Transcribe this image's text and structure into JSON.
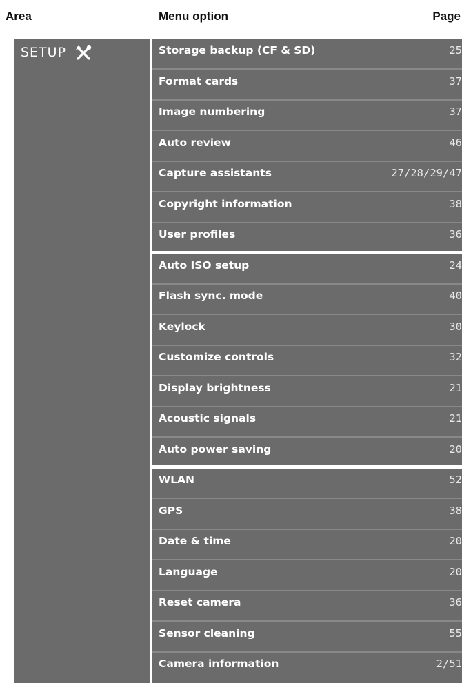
{
  "header": {
    "area": "Area",
    "menu_option": "Menu option",
    "page": "Page"
  },
  "area": {
    "label": "SETUP",
    "icon": "tools-icon"
  },
  "rows": [
    {
      "label": "Storage backup (CF & SD)",
      "page": "25"
    },
    {
      "label": "Format cards",
      "page": "37"
    },
    {
      "label": "Image numbering",
      "page": "37"
    },
    {
      "label": "Auto review",
      "page": "46"
    },
    {
      "label": "Capture assistants",
      "page": "27/28/29/47"
    },
    {
      "label": "Copyright information",
      "page": "38"
    },
    {
      "label": "User profiles",
      "page": "36"
    },
    {
      "label": "Auto ISO setup",
      "page": "24"
    },
    {
      "label": "Flash sync. mode",
      "page": "40"
    },
    {
      "label": "Keylock",
      "page": "30"
    },
    {
      "label": "Customize controls",
      "page": "32"
    },
    {
      "label": "Display brightness",
      "page": "21"
    },
    {
      "label": "Acoustic signals",
      "page": "21"
    },
    {
      "label": "Auto power saving",
      "page": "20"
    },
    {
      "label": "WLAN",
      "page": "52"
    },
    {
      "label": "GPS",
      "page": "38"
    },
    {
      "label": "Date & time",
      "page": "20"
    },
    {
      "label": "Language",
      "page": "20"
    },
    {
      "label": "Reset camera",
      "page": "36"
    },
    {
      "label": "Sensor cleaning",
      "page": "55"
    },
    {
      "label": "Camera information",
      "page": "2/51"
    }
  ],
  "group_breaks_after": [
    6,
    13
  ],
  "colors": {
    "cell_background": "#6b6b6b",
    "text": "#ffffff",
    "separator": "#888888"
  }
}
